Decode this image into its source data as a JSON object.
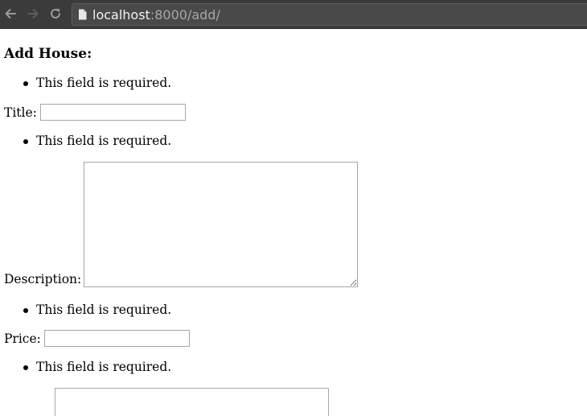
{
  "browser": {
    "url_host": "localhost",
    "url_rest": ":8000/add/"
  },
  "page": {
    "title": "Add House:"
  },
  "form": {
    "fields": [
      {
        "error": "This field is required.",
        "label": "Title:",
        "value": ""
      },
      {
        "error": "This field is required.",
        "label": "Description:",
        "value": ""
      },
      {
        "error": "This field is required.",
        "label": "Price:",
        "value": ""
      },
      {
        "error": "This field is required.",
        "value": ""
      }
    ]
  }
}
